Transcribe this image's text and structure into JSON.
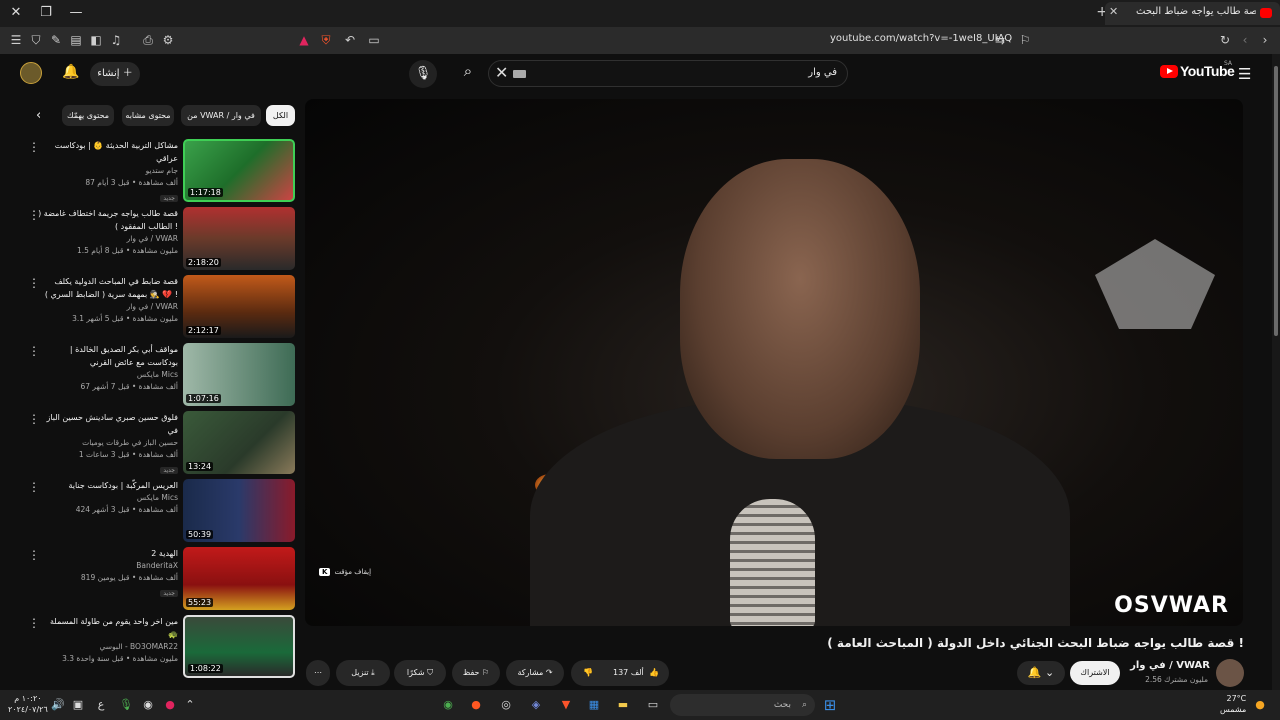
{
  "browser": {
    "tab_title": "قصة طالب يواجه ضباط البحث",
    "url": "youtube.com/watch?v=-1weI8_UIAQ"
  },
  "header": {
    "search_value": "في وار",
    "create_label": "إنشاء",
    "logo_text": "YouTube",
    "logo_region": "SA"
  },
  "chips": [
    "الكل",
    "من VWAR / في وار",
    "محتوى مشابه",
    "محتوى يهمّك"
  ],
  "recommendations": [
    {
      "title": "مشاكل التربية الحديثة 👶 | بودكاست عراقي",
      "channel": "جام ستديو",
      "meta": "87 ألف مشاهدة • قبل 3 أيام",
      "badge": "جديد",
      "duration": "1:17:18"
    },
    {
      "title": "قصة طالب يواجه جريمة اختطاف غامضة ( الطالب المفقود ) !",
      "channel": "في وار / VWAR",
      "meta": "1.5 مليون مشاهدة • قبل 8 أيام",
      "badge": "",
      "duration": "2:18:20"
    },
    {
      "title": "قصة ضابط في المباحث الدولية يكلف بمهمة سرية ( الضابط السري ) 🕵️ 💔 !",
      "channel": "في وار / VWAR",
      "meta": "3.1 مليون مشاهدة • قبل 5 أشهر",
      "badge": "",
      "duration": "2:12:17"
    },
    {
      "title": "مواقف أبي بكر الصديق الخالدة | بودكاست مع عائض القرني",
      "channel": "مايكس Mics",
      "meta": "67 ألف مشاهدة • قبل 7 أشهر",
      "badge": "",
      "duration": "1:07:16"
    },
    {
      "title": "فلوق حسين صبري سادينش حسين الباز في",
      "channel": "حسين الباز في طرقات يوميات",
      "meta": "1 ألف مشاهدة • قبل 3 ساعات",
      "badge": "جديد",
      "duration": "13:24"
    },
    {
      "title": "العريس المركّبة | بودكاست جناية",
      "channel": "مايكس Mics",
      "meta": "424 ألف مشاهدة • قبل 3 أشهر",
      "badge": "",
      "duration": "50:39"
    },
    {
      "title": "الهدية 2",
      "channel": "BanderitaX",
      "meta": "819 ألف مشاهدة • قبل يومين",
      "badge": "جديد",
      "duration": "55:23"
    },
    {
      "title": "مين اخر واحد يقوم من طاولة المسملة 🐢",
      "channel": "البوسي - BO3OMAR22",
      "meta": "3.3 مليون مشاهدة • قبل سنة واحدة",
      "badge": "",
      "duration": "1:08:22"
    }
  ],
  "video": {
    "watermark": "OSVWAR",
    "pause_hint": "إيقاف مؤقت",
    "pause_key": "K",
    "title": "قصة طالب يواجه ضباط البحث الجنائي داخل الدولة ( المباحث العامة ) !"
  },
  "actions": {
    "like_count": "137 ألف",
    "share_label": "مشاركة",
    "save_label": "حفظ",
    "thanks_label": "شكرًا",
    "download_label": "تنزيل",
    "subscribe_label": "الاشتراك",
    "channel_name": "في وار / VWAR",
    "channel_subs": "2.56 مليون مشترك"
  },
  "taskbar": {
    "search_placeholder": "بحث",
    "time": "١٠:٢٠ م",
    "date": "٢٠٢٤/٠٧/٢٦",
    "lang": "ع",
    "temperature": "27°C",
    "weather": "مشمس"
  }
}
